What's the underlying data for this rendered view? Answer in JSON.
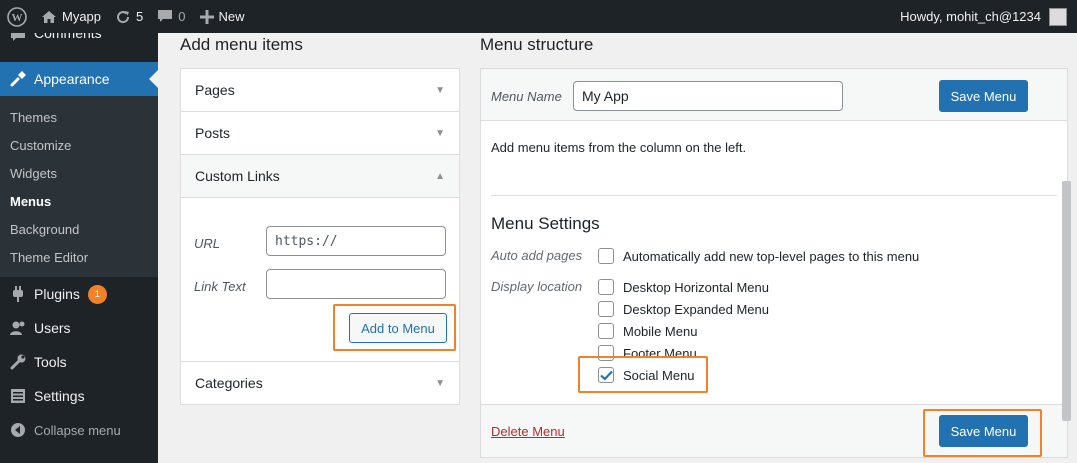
{
  "adminbar": {
    "site_name": "Myapp",
    "updates_count": "5",
    "comments_count": "0",
    "new_label": "New",
    "howdy": "Howdy, mohit_ch@1234"
  },
  "sidebar": {
    "partial_item": "Comments",
    "current_item": "Appearance",
    "submenu": [
      "Themes",
      "Customize",
      "Widgets",
      "Menus",
      "Background",
      "Theme Editor"
    ],
    "plugins": "Plugins",
    "plugins_badge": "1",
    "users": "Users",
    "tools": "Tools",
    "settings": "Settings",
    "collapse": "Collapse menu"
  },
  "add_items": {
    "title": "Add menu items",
    "sections": [
      "Pages",
      "Posts",
      "Custom Links",
      "Categories"
    ],
    "url_label": "URL",
    "url_placeholder": "https://",
    "link_text_label": "Link Text",
    "add_button": "Add to Menu"
  },
  "structure": {
    "title": "Menu structure",
    "menu_name_label": "Menu Name",
    "menu_name_value": "My App",
    "save_button": "Save Menu",
    "instructions": "Add menu items from the column on the left.",
    "settings_title": "Menu Settings",
    "auto_add_label": "Auto add pages",
    "auto_add_text": "Automatically add new top-level pages to this menu",
    "display_location_label": "Display location",
    "locations": [
      {
        "label": "Desktop Horizontal Menu",
        "checked": false
      },
      {
        "label": "Desktop Expanded Menu",
        "checked": false
      },
      {
        "label": "Mobile Menu",
        "checked": false
      },
      {
        "label": "Footer Menu",
        "checked": false
      },
      {
        "label": "Social Menu",
        "checked": true
      }
    ],
    "delete_link": "Delete Menu"
  },
  "colors": {
    "accent": "#2271b1",
    "highlight": "#f0822a",
    "sidebar_bg": "#1d2327",
    "danger": "#b32d2e"
  }
}
